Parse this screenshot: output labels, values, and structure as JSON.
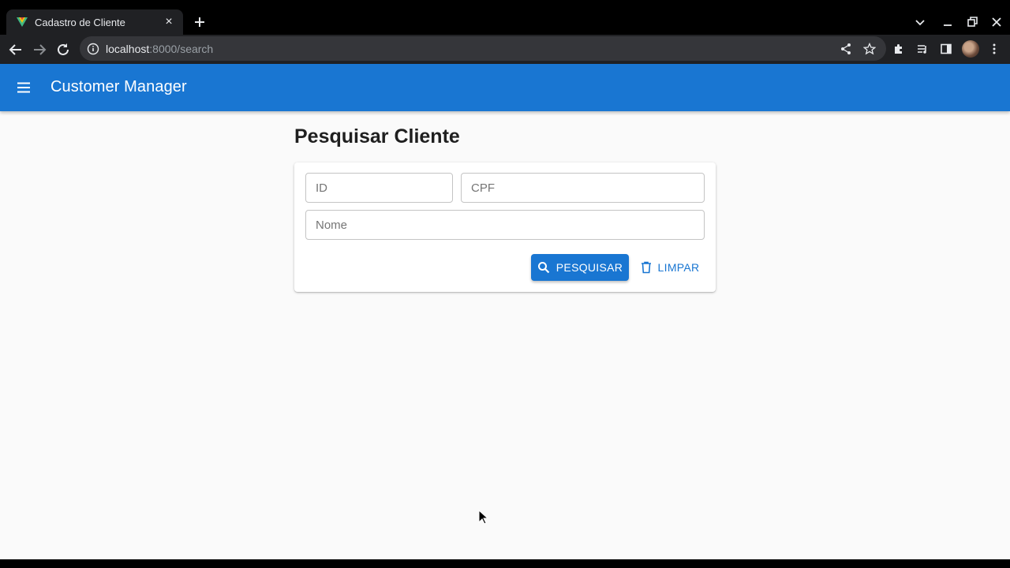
{
  "browser": {
    "tab_title": "Cadastro de Cliente",
    "url_host": "localhost",
    "url_rest": ":8000/search"
  },
  "app": {
    "title": "Customer Manager",
    "brand_color": "#1976d2"
  },
  "page": {
    "title": "Pesquisar Cliente"
  },
  "form": {
    "id_placeholder": "ID",
    "cpf_placeholder": "CPF",
    "nome_placeholder": "Nome",
    "search_label": "PESQUISAR",
    "clear_label": "LIMPAR"
  }
}
